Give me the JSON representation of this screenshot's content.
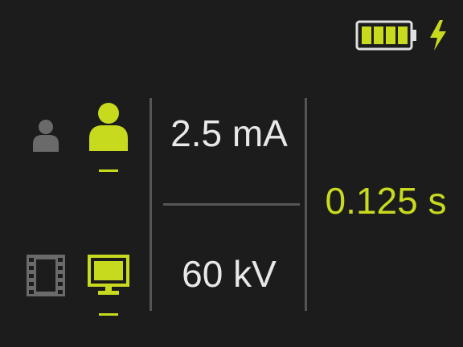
{
  "colors": {
    "background": "#1c1c1c",
    "accent": "#c8da1e",
    "inactive_icon": "#6a6a6a",
    "text": "#e8e8e8",
    "divider": "#555555"
  },
  "status": {
    "battery_icon": "battery-full-icon",
    "battery_level": 1.0,
    "charging_icon": "lightning-bolt-icon"
  },
  "patient_size": {
    "options": [
      "small-person-icon",
      "adult-person-icon"
    ],
    "selected": "adult-person-icon"
  },
  "receptor": {
    "options": [
      "film-icon",
      "monitor-icon"
    ],
    "selected": "monitor-icon"
  },
  "exposure": {
    "current": "2.5 mA",
    "voltage": "60 kV",
    "time": "0.125 s"
  }
}
